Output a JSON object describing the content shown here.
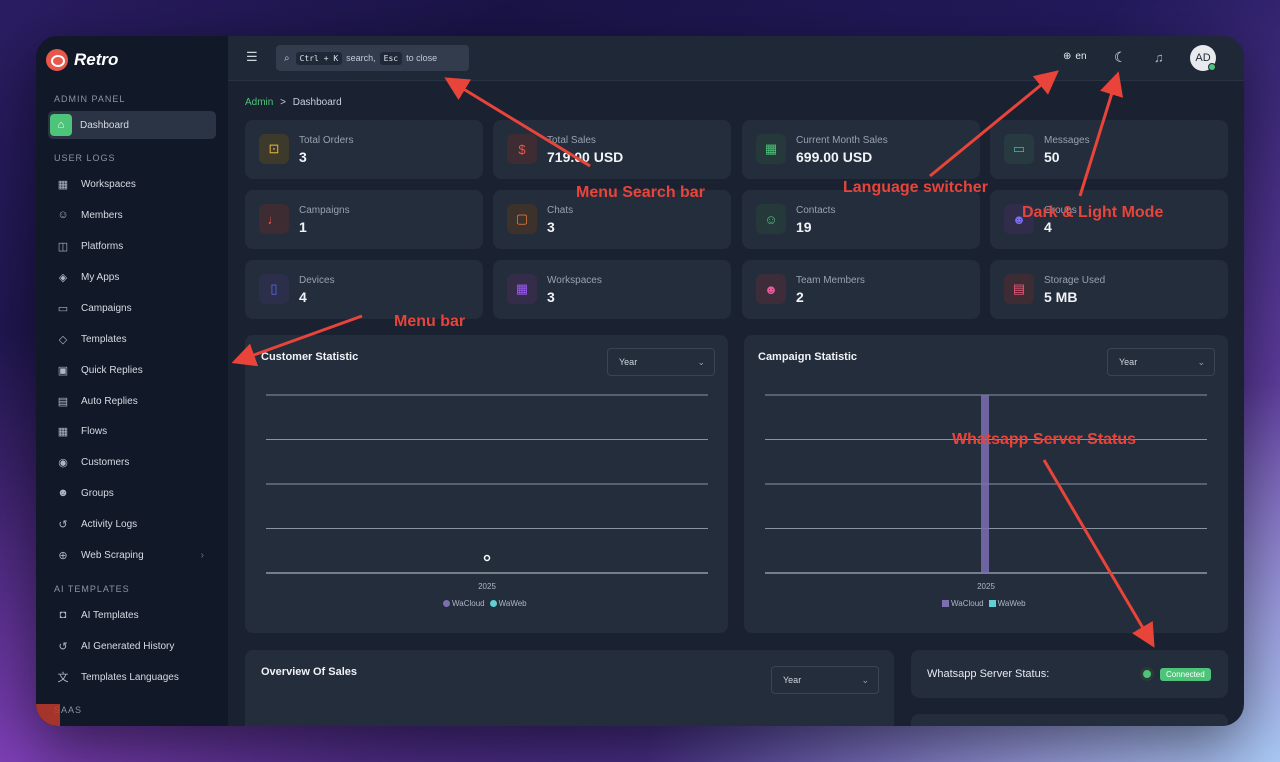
{
  "app": {
    "name": "Retro"
  },
  "sidebar": {
    "sections": [
      {
        "title": "ADMIN PANEL"
      },
      {
        "title": "USER LOGS"
      },
      {
        "title": "AI TEMPLATES"
      },
      {
        "title": "SAAS"
      }
    ],
    "items": [
      {
        "label": "Dashboard",
        "icon": "home-icon"
      },
      {
        "label": "Workspaces",
        "icon": "grid-icon"
      },
      {
        "label": "Members",
        "icon": "user-icon"
      },
      {
        "label": "Platforms",
        "icon": "platform-icon"
      },
      {
        "label": "My Apps",
        "icon": "apps-icon"
      },
      {
        "label": "Campaigns",
        "icon": "message-icon"
      },
      {
        "label": "Templates",
        "icon": "layers-icon"
      },
      {
        "label": "Quick Replies",
        "icon": "quick-reply-icon"
      },
      {
        "label": "Auto Replies",
        "icon": "auto-reply-icon"
      },
      {
        "label": "Flows",
        "icon": "flow-icon"
      },
      {
        "label": "Customers",
        "icon": "customer-icon"
      },
      {
        "label": "Groups",
        "icon": "group-icon"
      },
      {
        "label": "Activity Logs",
        "icon": "history-icon"
      },
      {
        "label": "Web Scraping",
        "icon": "globe-icon"
      },
      {
        "label": "AI Templates",
        "icon": "robot-icon"
      },
      {
        "label": "AI Generated History",
        "icon": "history-icon"
      },
      {
        "label": "Templates Languages",
        "icon": "translate-icon"
      }
    ]
  },
  "topbar": {
    "search": {
      "kbd1": "Ctrl + K",
      "text1": "search,",
      "kbd2": "Esc",
      "text2": "to close"
    },
    "language": "en",
    "avatar": "AD"
  },
  "breadcrumb": {
    "root": "Admin",
    "sep": ">",
    "current": "Dashboard"
  },
  "cards": [
    {
      "label": "Total Orders",
      "value": "3",
      "color": "#e8b73a"
    },
    {
      "label": "Total Sales",
      "value": "719.00 USD",
      "color": "#e8574a"
    },
    {
      "label": "Current Month Sales",
      "value": "699.00 USD",
      "color": "#4ec37a"
    },
    {
      "label": "Messages",
      "value": "50",
      "color": "#3bb8c4"
    },
    {
      "label": "Campaigns",
      "value": "1",
      "color": "#e8574a"
    },
    {
      "label": "Chats",
      "value": "3",
      "color": "#f07a3a"
    },
    {
      "label": "Contacts",
      "value": "19",
      "color": "#4ec37a"
    },
    {
      "label": "Groups",
      "value": "4",
      "color": "#7b6cf0"
    },
    {
      "label": "Devices",
      "value": "4",
      "color": "#5b6cf0"
    },
    {
      "label": "Workspaces",
      "value": "3",
      "color": "#9b5cf0"
    },
    {
      "label": "Team Members",
      "value": "2",
      "color": "#e85a9a"
    },
    {
      "label": "Storage Used",
      "value": "5 MB",
      "color": "#e85a7a"
    }
  ],
  "panels": {
    "customer": {
      "title": "Customer Statistic",
      "period": "Year"
    },
    "campaign": {
      "title": "Campaign Statistic",
      "period": "Year"
    },
    "sales": {
      "title": "Overview Of Sales",
      "period": "Year"
    },
    "server": {
      "label": "Whatsapp Server Status:",
      "status": "Connected"
    }
  },
  "chart_data": [
    {
      "type": "scatter",
      "title": "Customer Statistic",
      "x": [
        "2025"
      ],
      "series": [
        {
          "name": "WaCloud",
          "values": [
            0
          ],
          "color": "#7b6fb0"
        },
        {
          "name": "WaWeb",
          "values": [
            0
          ],
          "color": "#5fd0d6"
        }
      ],
      "grid": true,
      "legend": "bottom"
    },
    {
      "type": "bar",
      "title": "Campaign Statistic",
      "categories": [
        "2025"
      ],
      "series": [
        {
          "name": "WaCloud",
          "values": [
            1
          ],
          "color": "#7b6fb0"
        },
        {
          "name": "WaWeb",
          "values": [
            0
          ],
          "color": "#5fd0d6"
        }
      ],
      "ylim": [
        0,
        1
      ],
      "grid": true,
      "legend": "bottom"
    }
  ],
  "annotations": {
    "search": "Menu Search bar",
    "language": "Language switcher",
    "theme": "Dark & Light Mode",
    "menu": "Menu bar",
    "server": "Whatsapp Server Status"
  }
}
